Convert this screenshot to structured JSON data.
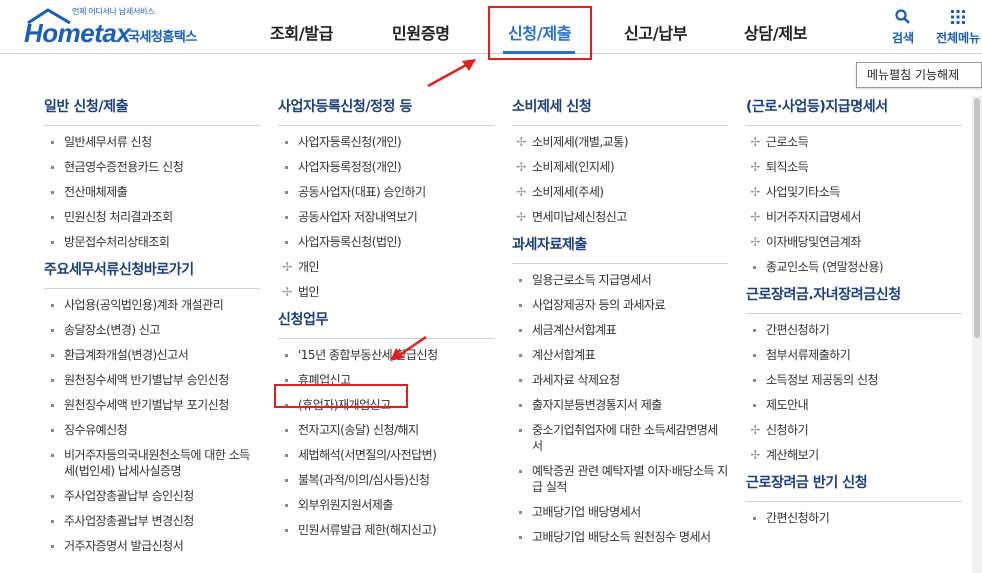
{
  "brand": {
    "tagline": "언제 어디서나 납세서비스",
    "name": "Hometax",
    "korean_name": "국세청홈택스"
  },
  "nav": [
    "조회/발급",
    "민원증명",
    "신청/제출",
    "신고/납부",
    "상담/제보"
  ],
  "nav_active": "신청/제출",
  "tools": {
    "search": "검색",
    "all_menu": "전체메뉴"
  },
  "toggle_button": "메뉴펼침 기능해제",
  "colors": {
    "accent": "#2a6fd1",
    "highlight": "#e02020",
    "section_title": "#1c3f7a"
  },
  "columns": [
    {
      "sections": [
        {
          "title": "일반 신청/제출",
          "items": [
            {
              "label": "일반세무서류 신청",
              "marker": "dot"
            },
            {
              "label": "현금영수증전용카드 신청",
              "marker": "dot"
            },
            {
              "label": "전산매체제출",
              "marker": "dot"
            },
            {
              "label": "민원신청 처리결과조회",
              "marker": "dot"
            },
            {
              "label": "방문접수처리상태조회",
              "marker": "dot"
            }
          ]
        },
        {
          "title": "주요세무서류신청바로가기",
          "items": [
            {
              "label": "사업용(공익법인용)계좌 개설관리",
              "marker": "dot"
            },
            {
              "label": "송달장소(변경) 신고",
              "marker": "dot"
            },
            {
              "label": "환급계좌개설(변경)신고서",
              "marker": "dot"
            },
            {
              "label": "원천징수세액 반기별납부 승인신청",
              "marker": "dot"
            },
            {
              "label": "원천징수세액 반기별납부 포기신청",
              "marker": "dot"
            },
            {
              "label": "징수유예신청",
              "marker": "dot"
            },
            {
              "label": "비거주자등의국내원천소득에 대한 소득세(법인세) 납세사실증명",
              "marker": "dot"
            },
            {
              "label": "주사업장총괄납부 승인신청",
              "marker": "dot"
            },
            {
              "label": "주사업장총괄납부 변경신청",
              "marker": "dot"
            },
            {
              "label": "거주자증명서 발급신청서",
              "marker": "dot"
            }
          ]
        }
      ]
    },
    {
      "sections": [
        {
          "title": "사업자등록신청/정정 등",
          "items": [
            {
              "label": "사업자등록신청(개인)",
              "marker": "dot"
            },
            {
              "label": "사업자등록정정(개인)",
              "marker": "dot"
            },
            {
              "label": "공동사업자(대표) 승인하기",
              "marker": "dot"
            },
            {
              "label": "공동사업자 저장내역보기",
              "marker": "dot"
            },
            {
              "label": "사업자등록신청(법인)",
              "marker": "dot"
            },
            {
              "label": "개인",
              "marker": "plus"
            },
            {
              "label": "법인",
              "marker": "plus"
            }
          ]
        },
        {
          "title": "신청업무",
          "items": [
            {
              "label": "'15년 종합부동산세 환급신청",
              "marker": "dot"
            },
            {
              "label": "휴폐업신고",
              "marker": "dot"
            },
            {
              "label": "(휴업자)재개업신고",
              "marker": "dot"
            },
            {
              "label": "전자고지(송달) 신청/해지",
              "marker": "dot"
            },
            {
              "label": "세법해석(서면질의/사전답변)",
              "marker": "dot"
            },
            {
              "label": "불복(과적/이의/심사등)신청",
              "marker": "dot"
            },
            {
              "label": "외부위원지원서제출",
              "marker": "dot"
            },
            {
              "label": "민원서류발급 제한(해지신고)",
              "marker": "dot"
            }
          ]
        }
      ]
    },
    {
      "sections": [
        {
          "title": "소비제세 신청",
          "items": [
            {
              "label": "소비제세(개별,교통)",
              "marker": "plus"
            },
            {
              "label": "소비제세(인지세)",
              "marker": "plus"
            },
            {
              "label": "소비제세(주세)",
              "marker": "plus"
            },
            {
              "label": "면세미납세신청신고",
              "marker": "plus"
            }
          ]
        },
        {
          "title": "과세자료제출",
          "items": [
            {
              "label": "일용근로소득 지급명세서",
              "marker": "dot"
            },
            {
              "label": "사업장제공자 등의 과세자료",
              "marker": "dot"
            },
            {
              "label": "세금계산서합계표",
              "marker": "dot"
            },
            {
              "label": "계산서합계표",
              "marker": "dot"
            },
            {
              "label": "과세자료 삭제요청",
              "marker": "dot"
            },
            {
              "label": "출자지분등변경통지서 제출",
              "marker": "dot"
            },
            {
              "label": "중소기업취업자에 대한 소득세감면명세서",
              "marker": "dot"
            },
            {
              "label": "예탁증권 관련 예탁자별 이자·배당소득 지급 실적",
              "marker": "dot"
            },
            {
              "label": "고배당기업 배당명세서",
              "marker": "dot"
            },
            {
              "label": "고배당기업 배당소득 원천징수 명세서",
              "marker": "dot"
            }
          ]
        }
      ]
    },
    {
      "sections": [
        {
          "title": "(근로·사업등)지급명세서",
          "items": [
            {
              "label": "근로소득",
              "marker": "plus"
            },
            {
              "label": "퇴직소득",
              "marker": "plus"
            },
            {
              "label": "사업및기타소득",
              "marker": "plus"
            },
            {
              "label": "비거주자지급명세서",
              "marker": "plus"
            },
            {
              "label": "이자배당및연금계좌",
              "marker": "plus"
            },
            {
              "label": "종교인소득 (연말정산용)",
              "marker": "dot"
            }
          ]
        },
        {
          "title": "근로장려금.자녀장려금신청",
          "items": [
            {
              "label": "간편신청하기",
              "marker": "dot"
            },
            {
              "label": "첨부서류제출하기",
              "marker": "dot"
            },
            {
              "label": "소득정보 제공동의 신청",
              "marker": "dot"
            },
            {
              "label": "제도안내",
              "marker": "dot"
            },
            {
              "label": "신청하기",
              "marker": "plus"
            },
            {
              "label": "계산해보기",
              "marker": "plus"
            }
          ]
        },
        {
          "title": "근로장려금 반기 신청",
          "items": [
            {
              "label": "간편신청하기",
              "marker": "dot"
            }
          ]
        }
      ]
    }
  ]
}
